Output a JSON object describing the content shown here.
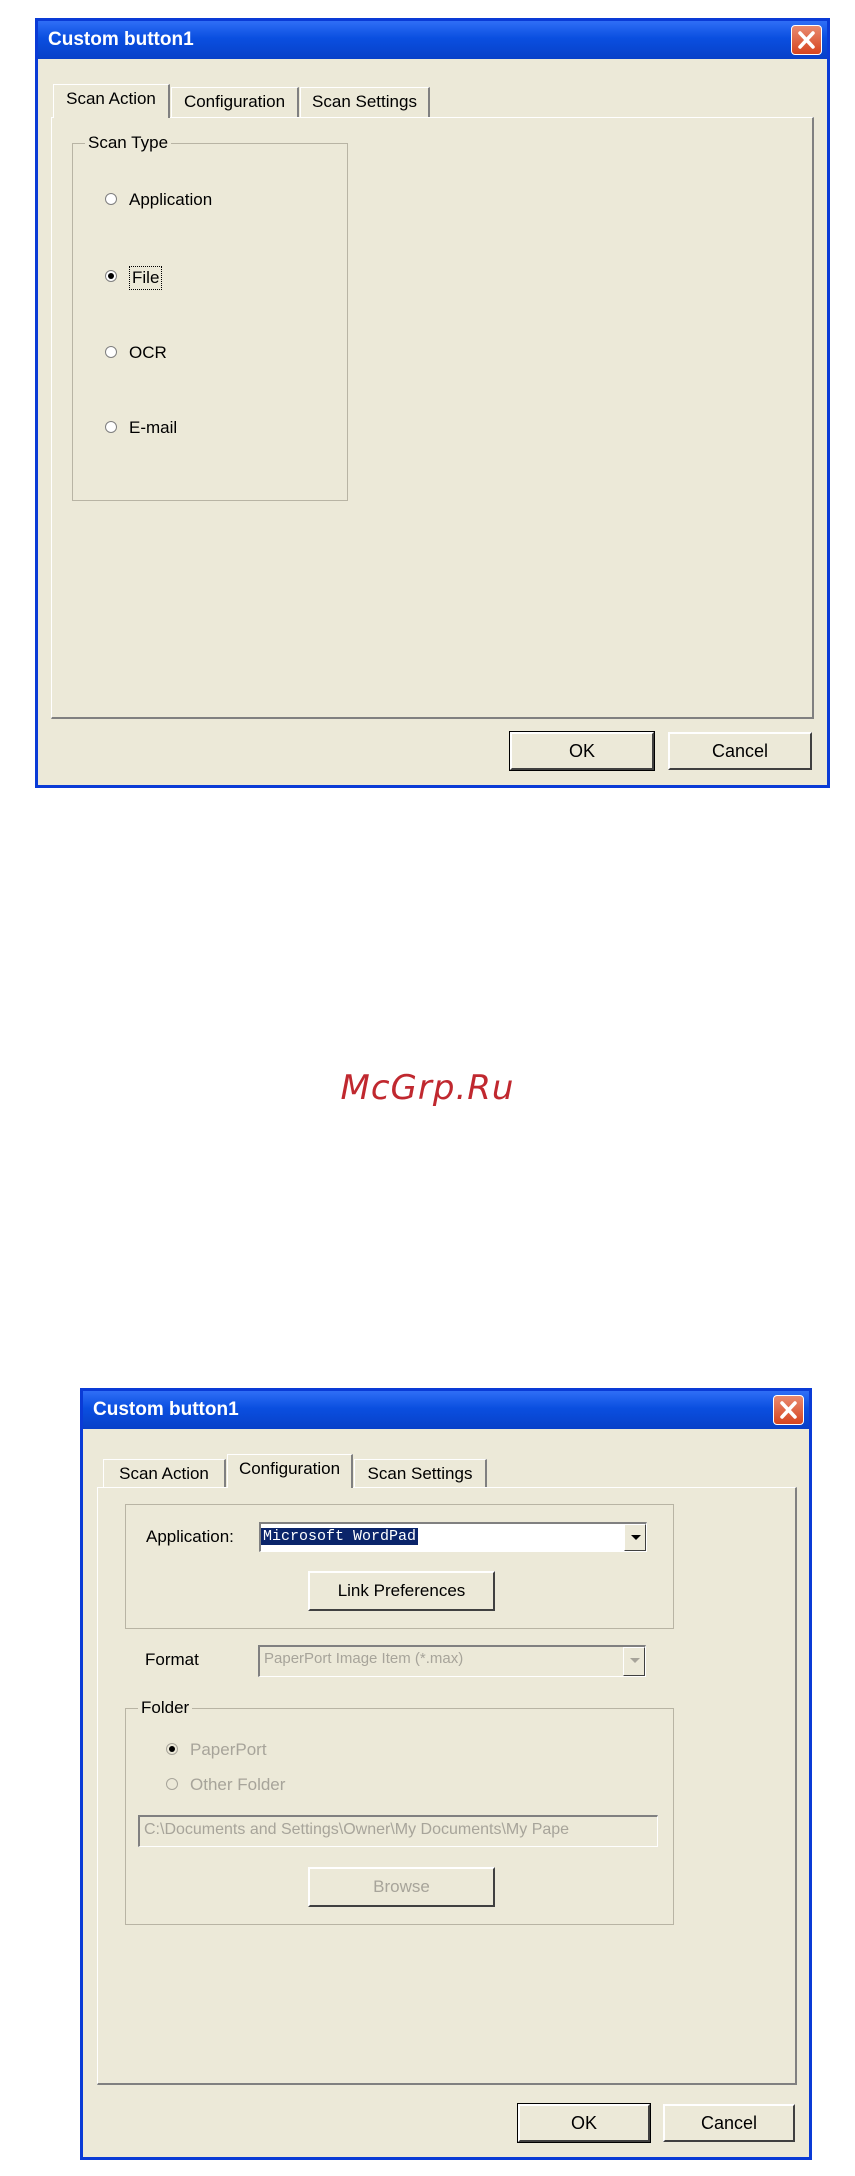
{
  "watermark": "McGrp.Ru",
  "dialog1": {
    "title": "Custom button1",
    "tabs": [
      "Scan Action",
      "Configuration",
      "Scan Settings"
    ],
    "active_tab": "Scan Action",
    "scan_type": {
      "legend": "Scan Type",
      "options": [
        {
          "label": "Application",
          "checked": false
        },
        {
          "label": "File",
          "checked": true
        },
        {
          "label": "OCR",
          "checked": false
        },
        {
          "label": "E-mail",
          "checked": false
        }
      ]
    },
    "ok_label": "OK",
    "cancel_label": "Cancel"
  },
  "dialog2": {
    "title": "Custom button1",
    "tabs": [
      "Scan Action",
      "Configuration",
      "Scan Settings"
    ],
    "active_tab": "Configuration",
    "application_label": "Application:",
    "application_value": "Microsoft WordPad",
    "link_preferences_label": "Link Preferences",
    "format_label": "Format",
    "format_value": "PaperPort Image Item (*.max)",
    "folder_legend": "Folder",
    "folder_options": [
      {
        "label": "PaperPort",
        "checked": true
      },
      {
        "label": "Other Folder",
        "checked": false
      }
    ],
    "folder_path": "C:\\Documents and Settings\\Owner\\My Documents\\My Pape",
    "browse_label": "Browse",
    "ok_label": "OK",
    "cancel_label": "Cancel"
  }
}
